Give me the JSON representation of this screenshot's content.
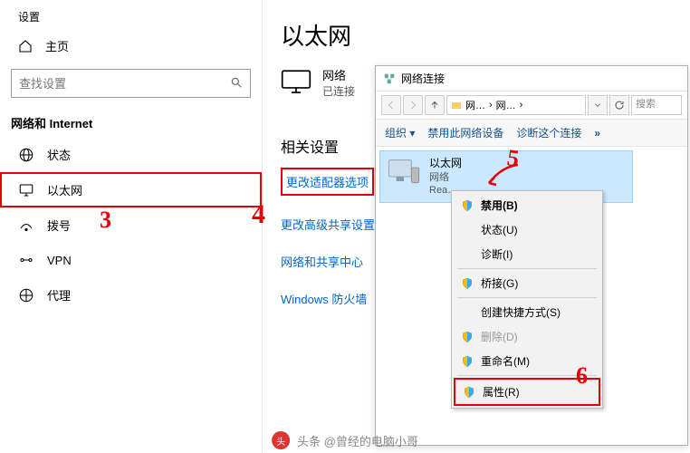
{
  "settings": {
    "title": "设置",
    "home": "主页",
    "search_placeholder": "查找设置",
    "section": "网络和 Internet",
    "nav": [
      {
        "icon": "status",
        "label": "状态"
      },
      {
        "icon": "ethernet",
        "label": "以太网"
      },
      {
        "icon": "dialup",
        "label": "拨号"
      },
      {
        "icon": "vpn",
        "label": "VPN"
      },
      {
        "icon": "proxy",
        "label": "代理"
      }
    ]
  },
  "main": {
    "title": "以太网",
    "ethernet": {
      "name": "网络",
      "status": "已连接"
    },
    "related_head": "相关设置",
    "links": {
      "adapter": "更改适配器选项",
      "sharing": "更改高级共享设置",
      "center": "网络和共享中心",
      "firewall": "Windows 防火墙"
    }
  },
  "popup": {
    "title": "网络连接",
    "breadcrumb1": "网…",
    "breadcrumb2": "网…",
    "search_hint": "搜索",
    "cmd_organize": "组织",
    "cmd_disable": "禁用此网络设备",
    "cmd_diagnose": "诊断这个连接",
    "cmd_more": "»",
    "adapter": {
      "name": "以太网",
      "network": "网络",
      "driver": "Rea…"
    }
  },
  "ctx": {
    "disable": "禁用(B)",
    "status": "状态(U)",
    "diagnose": "诊断(I)",
    "bridge": "桥接(G)",
    "shortcut": "创建快捷方式(S)",
    "delete": "删除(D)",
    "rename": "重命名(M)",
    "properties": "属性(R)"
  },
  "annotations": {
    "n3": "3",
    "n4": "4",
    "n5": "5",
    "n6": "6"
  },
  "watermark": {
    "text": "头条 @曾经的电脑小哥"
  }
}
